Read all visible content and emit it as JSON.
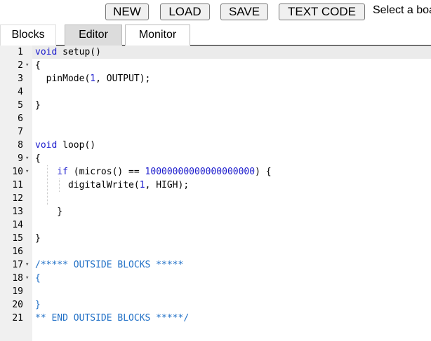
{
  "toolbar": {
    "new_label": "NEW",
    "load_label": "LOAD",
    "save_label": "SAVE",
    "text_code_label": "TEXT CODE",
    "board_label": "Select a boa"
  },
  "tabs": [
    {
      "label": "Blocks"
    },
    {
      "label": "Editor"
    },
    {
      "label": "Monitor"
    }
  ],
  "editor": {
    "lines": [
      {
        "n": "1",
        "fold": false,
        "parts": [
          [
            "kw",
            "void"
          ],
          [
            "",
            "setup()"
          ]
        ]
      },
      {
        "n": "2",
        "fold": true,
        "parts": [
          [
            "",
            "{"
          ]
        ]
      },
      {
        "n": "3",
        "fold": false,
        "parts": [
          [
            "",
            "  pinMode("
          ],
          [
            "num",
            "1"
          ],
          [
            "",
            ", OUTPUT);"
          ]
        ]
      },
      {
        "n": "4",
        "fold": false,
        "parts": []
      },
      {
        "n": "5",
        "fold": false,
        "parts": [
          [
            "",
            "}"
          ]
        ]
      },
      {
        "n": "6",
        "fold": false,
        "parts": []
      },
      {
        "n": "7",
        "fold": false,
        "parts": []
      },
      {
        "n": "8",
        "fold": false,
        "parts": [
          [
            "kw",
            "void"
          ],
          [
            "",
            "loop()"
          ]
        ]
      },
      {
        "n": "9",
        "fold": true,
        "parts": [
          [
            "",
            "{"
          ]
        ]
      },
      {
        "n": "10",
        "fold": true,
        "parts": [
          [
            "",
            "    "
          ],
          [
            "kw",
            "if"
          ],
          [
            "",
            " (micros() == "
          ],
          [
            "num",
            "10000000000000000000"
          ],
          [
            "",
            ") {"
          ]
        ]
      },
      {
        "n": "11",
        "fold": false,
        "parts": [
          [
            "",
            "      digitalWrite("
          ],
          [
            "num",
            "1"
          ],
          [
            "",
            ", HIGH);"
          ]
        ]
      },
      {
        "n": "12",
        "fold": false,
        "parts": []
      },
      {
        "n": "13",
        "fold": false,
        "parts": [
          [
            "",
            "    }"
          ]
        ]
      },
      {
        "n": "14",
        "fold": false,
        "parts": []
      },
      {
        "n": "15",
        "fold": false,
        "parts": [
          [
            "",
            "}"
          ]
        ]
      },
      {
        "n": "16",
        "fold": false,
        "parts": []
      },
      {
        "n": "17",
        "fold": true,
        "parts": [
          [
            "cm",
            "/***** OUTSIDE BLOCKS *****"
          ]
        ]
      },
      {
        "n": "18",
        "fold": true,
        "parts": [
          [
            "cm",
            "{"
          ]
        ]
      },
      {
        "n": "19",
        "fold": false,
        "parts": []
      },
      {
        "n": "20",
        "fold": false,
        "parts": [
          [
            "cm",
            "}"
          ]
        ]
      },
      {
        "n": "21",
        "fold": false,
        "parts": [
          [
            "cm",
            "** END OUTSIDE BLOCKS *****/"
          ]
        ]
      }
    ]
  }
}
